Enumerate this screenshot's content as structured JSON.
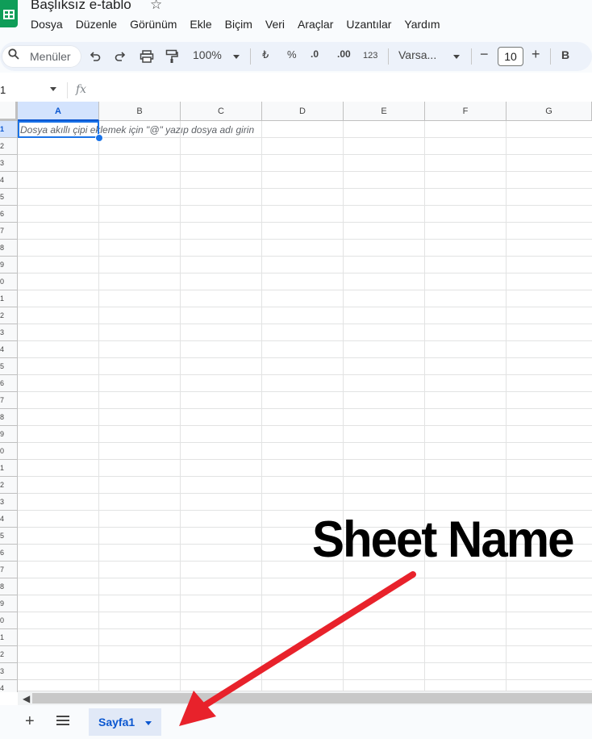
{
  "app": {
    "title": "Başlıksız e-tablo",
    "star_icon": "star-outline-icon"
  },
  "menu": [
    "Dosya",
    "Düzenle",
    "Görünüm",
    "Ekle",
    "Biçim",
    "Veri",
    "Araçlar",
    "Uzantılar",
    "Yardım"
  ],
  "toolbar": {
    "search_placeholder": "Menüler",
    "zoom": "100%",
    "currency": "₺",
    "percent": "%",
    "decrease_decimal": ".0",
    "increase_decimal": ".00",
    "number_format": "123",
    "font": "Varsa...",
    "font_size": "10",
    "bold": "B",
    "minus": "−",
    "plus": "+"
  },
  "formula_bar": {
    "name_box": "1",
    "fx": "fx"
  },
  "grid": {
    "columns": [
      "A",
      "B",
      "C",
      "D",
      "E",
      "F",
      "G"
    ],
    "rows": [
      "1",
      "2",
      "3",
      "4",
      "5",
      "6",
      "7",
      "8",
      "9",
      "0",
      "1",
      "2",
      "3",
      "4",
      "5",
      "6",
      "7",
      "8",
      "9",
      "0",
      "1",
      "2",
      "3",
      "4",
      "5",
      "6",
      "7",
      "8",
      "9",
      "0",
      "1",
      "2",
      "3",
      "4"
    ],
    "hint": "Dosya akıllı çipi eklemek için \"@\" yazıp dosya adı girin"
  },
  "bottom": {
    "add_sheet": "+",
    "sheet_tab": "Sayfa1"
  },
  "annotation": {
    "text": "Sheet Name",
    "arrow_color": "#e8222b"
  }
}
